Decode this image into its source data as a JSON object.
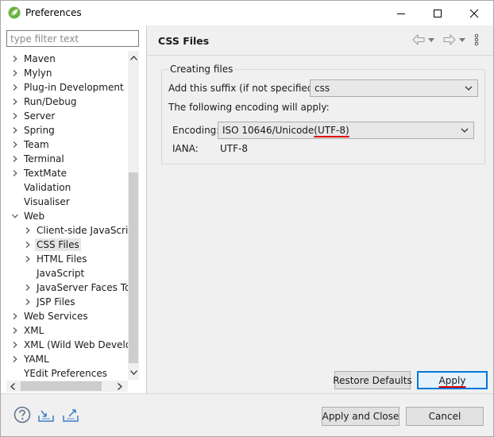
{
  "window": {
    "title": "Preferences"
  },
  "filter": {
    "placeholder": "type filter text"
  },
  "tree": [
    {
      "label": "Maven",
      "level": 0,
      "expander": "collapsed"
    },
    {
      "label": "Mylyn",
      "level": 0,
      "expander": "collapsed"
    },
    {
      "label": "Plug-in Development",
      "level": 0,
      "expander": "collapsed"
    },
    {
      "label": "Run/Debug",
      "level": 0,
      "expander": "collapsed"
    },
    {
      "label": "Server",
      "level": 0,
      "expander": "collapsed"
    },
    {
      "label": "Spring",
      "level": 0,
      "expander": "collapsed"
    },
    {
      "label": "Team",
      "level": 0,
      "expander": "collapsed"
    },
    {
      "label": "Terminal",
      "level": 0,
      "expander": "collapsed"
    },
    {
      "label": "TextMate",
      "level": 0,
      "expander": "collapsed"
    },
    {
      "label": "Validation",
      "level": 0,
      "expander": "none"
    },
    {
      "label": "Visualiser",
      "level": 0,
      "expander": "none"
    },
    {
      "label": "Web",
      "level": 0,
      "expander": "expanded"
    },
    {
      "label": "Client-side JavaScript",
      "level": 1,
      "expander": "collapsed"
    },
    {
      "label": "CSS Files",
      "level": 1,
      "expander": "collapsed",
      "selected": true
    },
    {
      "label": "HTML Files",
      "level": 1,
      "expander": "collapsed"
    },
    {
      "label": "JavaScript",
      "level": 1,
      "expander": "none"
    },
    {
      "label": "JavaServer Faces Tools",
      "level": 1,
      "expander": "collapsed"
    },
    {
      "label": "JSP Files",
      "level": 1,
      "expander": "collapsed"
    },
    {
      "label": "Web Services",
      "level": 0,
      "expander": "collapsed"
    },
    {
      "label": "XML",
      "level": 0,
      "expander": "collapsed"
    },
    {
      "label": "XML (Wild Web Developer)",
      "level": 0,
      "expander": "collapsed"
    },
    {
      "label": "YAML",
      "level": 0,
      "expander": "collapsed"
    },
    {
      "label": "YEdit Preferences",
      "level": 0,
      "expander": "none"
    }
  ],
  "page": {
    "title": "CSS Files",
    "group_title": "Creating files",
    "suffix_label": "Add this suffix (if not specified):",
    "suffix_value": "css",
    "encoding_note": "The following encoding will apply:",
    "encoding_label": "Encoding:",
    "encoding_value_prefix": "ISO 10646/Unicode",
    "encoding_value_suffix": "(UTF-8)",
    "iana_label": "IANA:",
    "iana_value": "UTF-8"
  },
  "buttons": {
    "restore_defaults": "Restore Defaults",
    "apply": "Apply",
    "apply_and_close": "Apply and Close",
    "cancel": "Cancel"
  },
  "colors": {
    "accent": "#0078d7",
    "annotation_underline": "#e00000"
  }
}
